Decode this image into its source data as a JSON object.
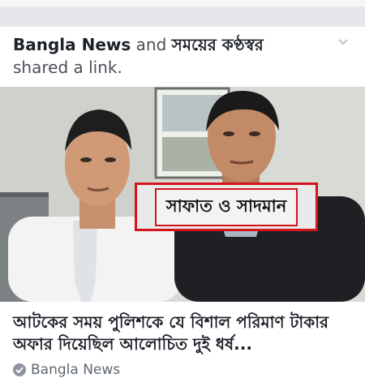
{
  "post": {
    "page1": "Bangla News",
    "and_word": " and ",
    "page2": "সময়ের কণ্ঠস্বর",
    "action": "shared a link."
  },
  "link": {
    "image_caption": "সাফাত ও সাদমান",
    "headline": "আটকের সময় পুলিশকে যে বিশাল পরিমাণ টাকার অফার দিয়েছিল আলোচিত দুই ধর্ষ...",
    "source": "Bangla News"
  },
  "icons": {
    "menu": "chevron-down-icon",
    "source": "verified-check-icon"
  }
}
